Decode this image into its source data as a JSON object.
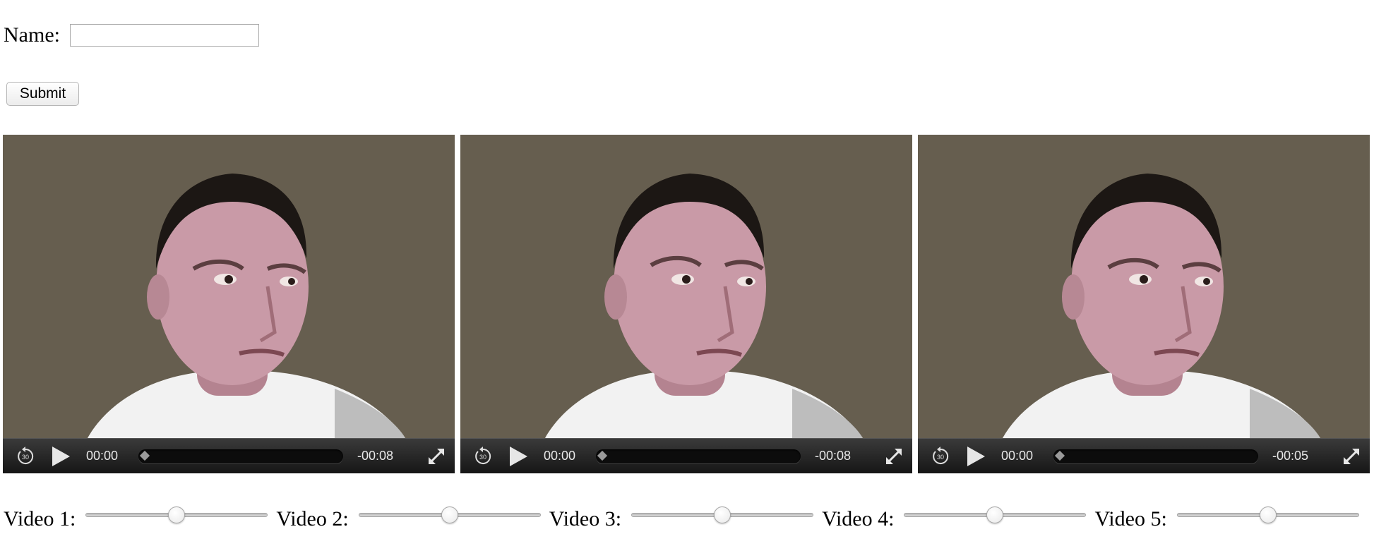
{
  "form": {
    "name_label": "Name:",
    "name_value": "",
    "name_placeholder": "",
    "submit_label": "Submit"
  },
  "videos": [
    {
      "current_time": "00:00",
      "remaining_time": "-00:08",
      "progress": 0
    },
    {
      "current_time": "00:00",
      "remaining_time": "-00:08",
      "progress": 0
    },
    {
      "current_time": "00:00",
      "remaining_time": "-00:05",
      "progress": 0
    }
  ],
  "player_icons": {
    "rewind": "rewind-30-icon",
    "play": "play-icon",
    "fullscreen": "fullscreen-icon"
  },
  "sliders": [
    {
      "label": "Video 1:",
      "value": 50
    },
    {
      "label": "Video 2:",
      "value": 50
    },
    {
      "label": "Video 3:",
      "value": 50
    },
    {
      "label": "Video 4:",
      "value": 50
    },
    {
      "label": "Video 5:",
      "value": 50
    }
  ],
  "colors": {
    "video_background": "#665e4f",
    "control_bar": "#1f1f1f",
    "control_text": "#e8e8e8"
  }
}
